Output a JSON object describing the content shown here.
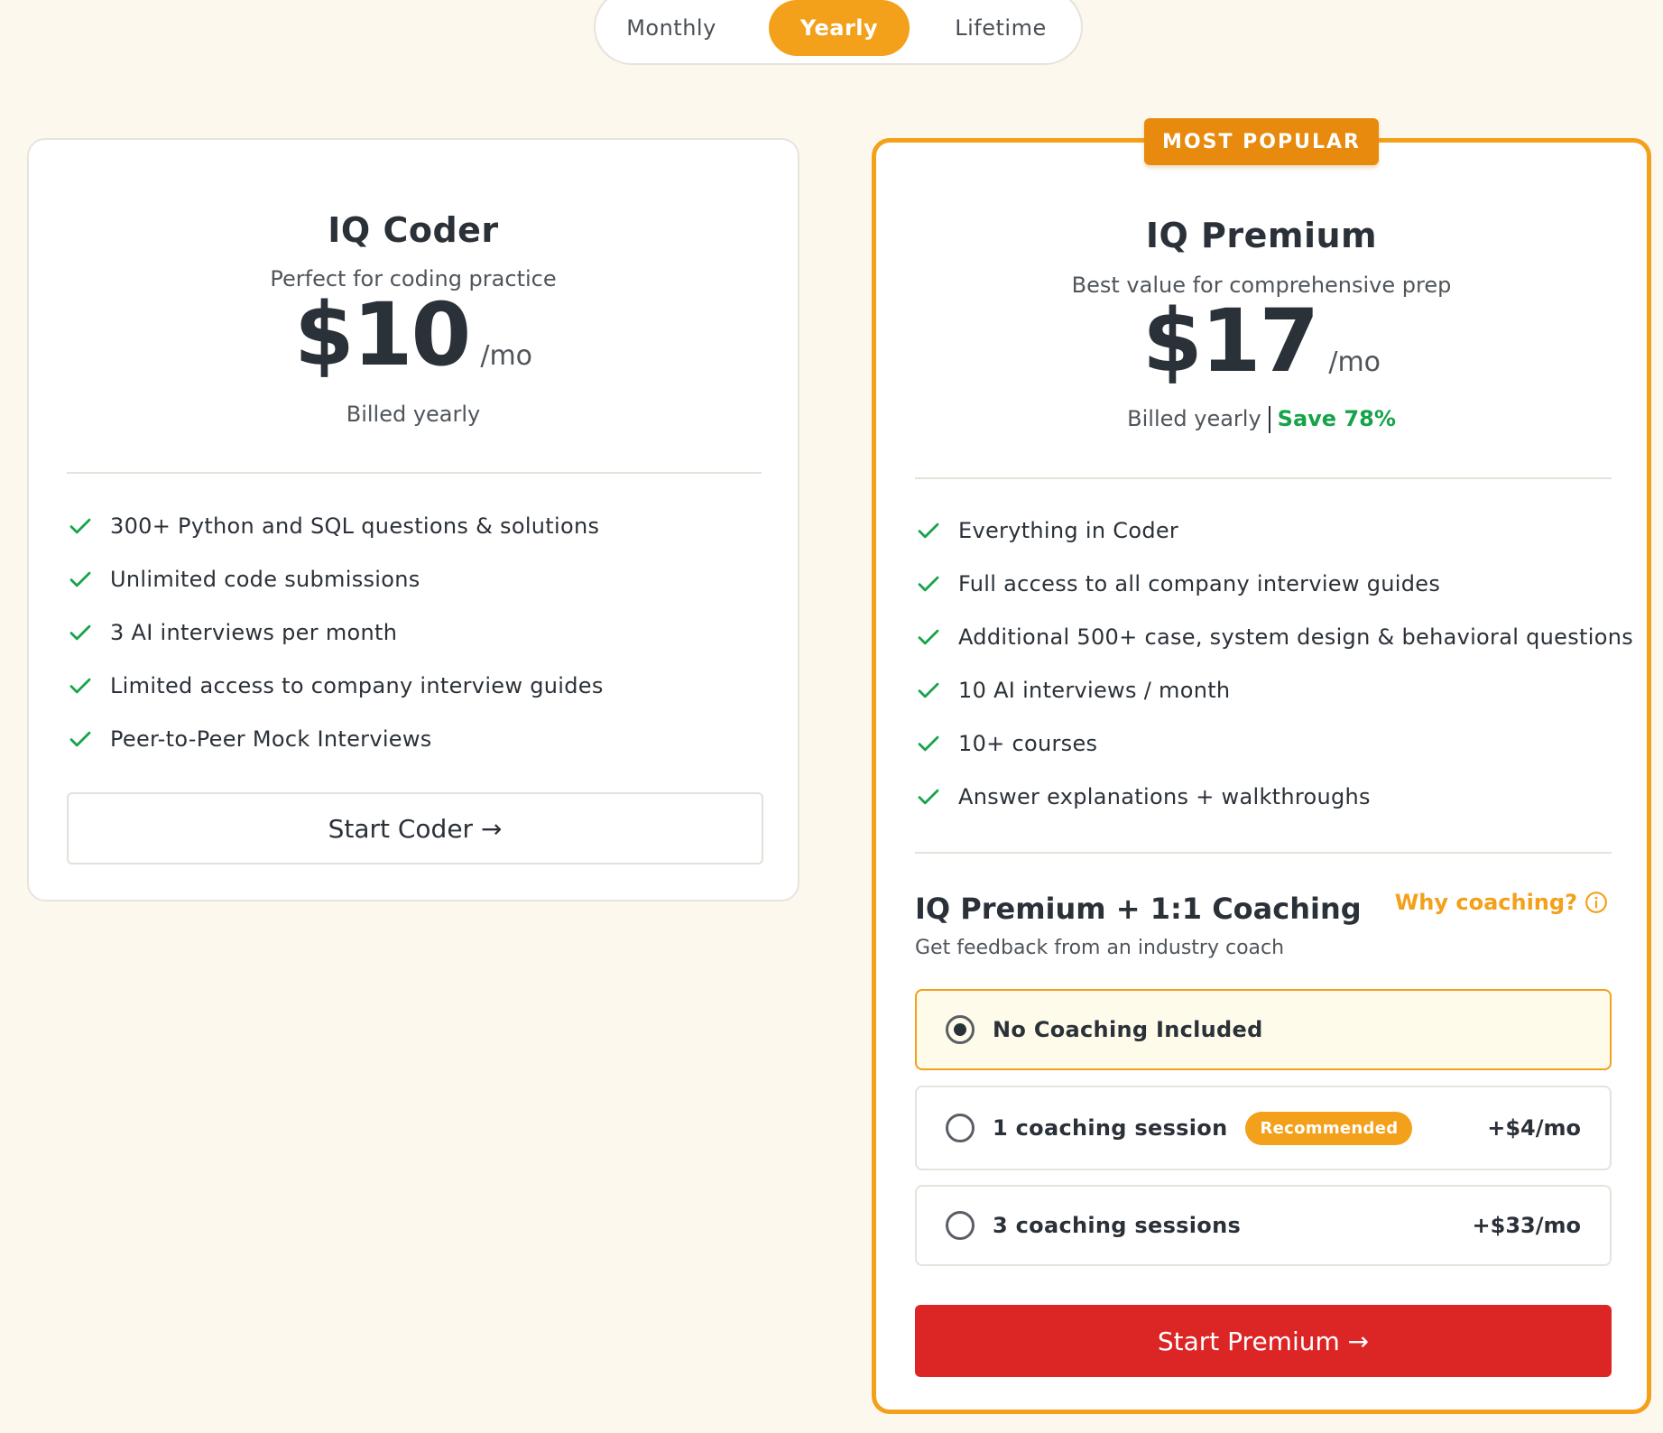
{
  "billing_toggle": {
    "options": [
      "Monthly",
      "Yearly",
      "Lifetime"
    ],
    "selected": "Yearly"
  },
  "plans": {
    "coder": {
      "title": "IQ Coder",
      "subtitle": "Perfect for coding practice",
      "price": "$10",
      "per": "/mo",
      "billed": "Billed yearly",
      "features": [
        "300+ Python and SQL questions & solutions",
        "Unlimited code submissions",
        "3 AI interviews per month",
        "Limited access to company interview guides",
        "Peer-to-Peer Mock Interviews"
      ],
      "cta": "Start Coder →"
    },
    "premium": {
      "badge": "MOST POPULAR",
      "title": "IQ Premium",
      "subtitle": "Best value for comprehensive prep",
      "price": "$17",
      "per": "/mo",
      "billed": "Billed yearly",
      "save": "Save 78%",
      "features": [
        "Everything in Coder",
        "Full access to all company interview guides",
        "Additional 500+ case, system design & behavioral questions",
        "10 AI interviews / month",
        "10+ courses",
        "Answer explanations + walkthroughs"
      ],
      "coaching": {
        "title": "IQ Premium + 1:1 Coaching",
        "why_link": "Why coaching?",
        "subtitle": "Get feedback from an industry coach",
        "options": [
          {
            "label": "No Coaching Included",
            "price": "",
            "badge": "",
            "selected": true
          },
          {
            "label": "1 coaching session",
            "price": "+$4/mo",
            "badge": "Recommended",
            "selected": false
          },
          {
            "label": "3 coaching sessions",
            "price": "+$33/mo",
            "badge": "",
            "selected": false
          }
        ]
      },
      "cta": "Start Premium →"
    }
  },
  "colors": {
    "accent": "#f3a01a",
    "badge": "#e88a0d",
    "save_green": "#16a34a",
    "cta_red": "#dc2626",
    "page_bg": "#fdf8ed"
  },
  "icons": {
    "feature_check": "check-icon",
    "why_info": "info-icon"
  }
}
